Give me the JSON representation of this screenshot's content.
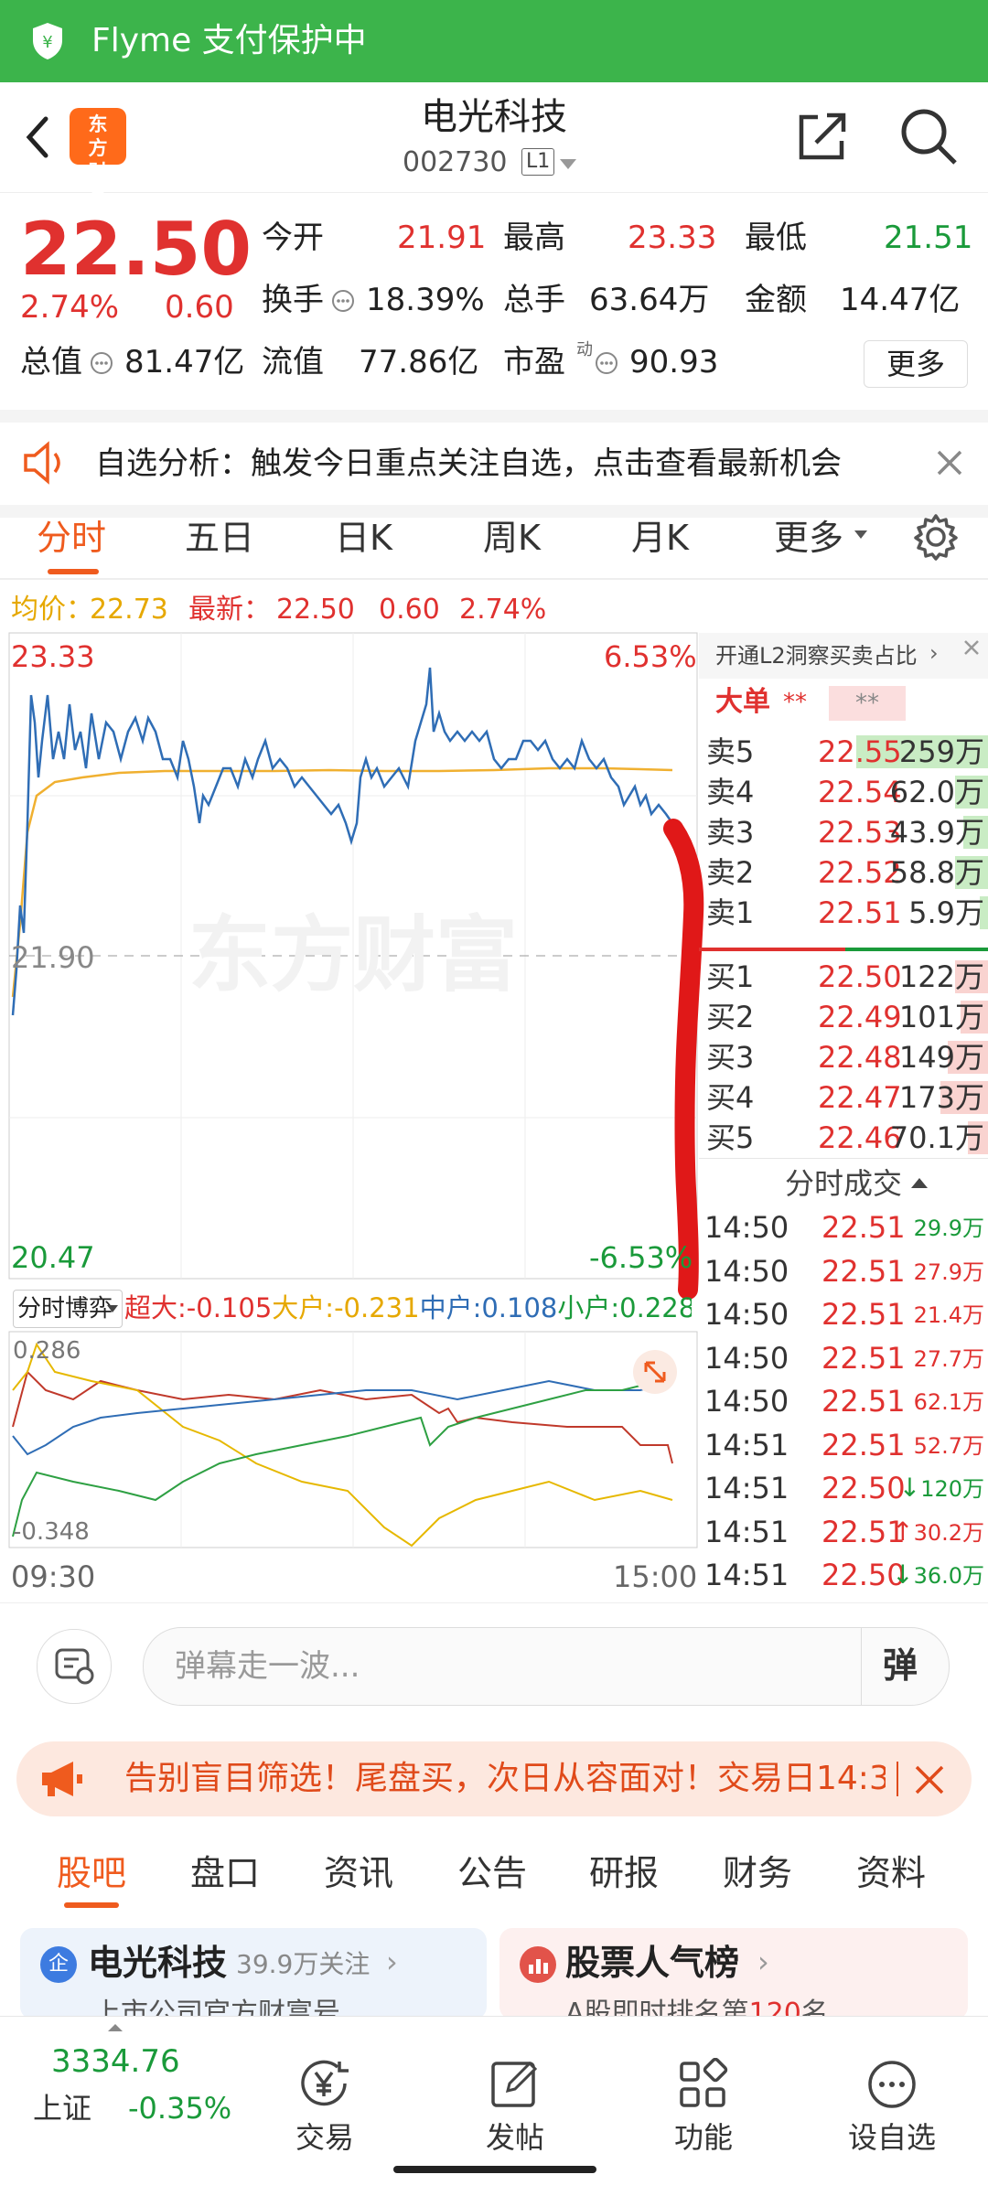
{
  "status_bar": {
    "text": "Flyme 支付保护中"
  },
  "header": {
    "logo_text": "东方财富",
    "title": "电光科技",
    "code": "002730",
    "level": "L1"
  },
  "quote": {
    "price": "22.50",
    "change_pct": "2.74%",
    "change": "0.60",
    "stats": [
      {
        "label": "今开",
        "value": "21.91",
        "color": "red"
      },
      {
        "label": "最高",
        "value": "23.33",
        "color": "red"
      },
      {
        "label": "最低",
        "value": "21.51",
        "color": "green"
      },
      {
        "label": "换手",
        "value": "18.39%",
        "color": "black"
      },
      {
        "label": "总手",
        "value": "63.64万",
        "color": "black"
      },
      {
        "label": "金额",
        "value": "14.47亿",
        "color": "black"
      },
      {
        "label": "总值",
        "value": "81.47亿",
        "color": "black"
      },
      {
        "label": "流值",
        "value": "77.86亿",
        "color": "black"
      },
      {
        "label": "市盈",
        "value": "90.93",
        "color": "black"
      }
    ],
    "pe_sup": "动",
    "more_button": "更多"
  },
  "notice": {
    "text": "自选分析：触发今日重点关注自选，点击查看最新机会"
  },
  "chart_tabs": [
    "分时",
    "五日",
    "日K",
    "周K",
    "月K",
    "更多"
  ],
  "chart_summary": {
    "avg_label": "均价：",
    "avg_value": "22.73",
    "latest_label": "最新：",
    "latest_value": "22.50",
    "change": "0.60",
    "change_pct": "2.74%"
  },
  "chart_labels": {
    "high": "23.33",
    "high_pct": "6.53%",
    "mid": "21.90",
    "low": "20.47",
    "low_pct": "-6.53%",
    "watermark": "东方财富",
    "start_time": "09:30",
    "end_time": "15:00",
    "ff_high": "0.286",
    "ff_low": "-0.348"
  },
  "fund_flow": {
    "selector": "分时博弈",
    "items": [
      {
        "label": "超大:",
        "value": "-0.105",
        "color": "#e0312f"
      },
      {
        "label": "大户:",
        "value": "-0.231",
        "color": "#e6a800"
      },
      {
        "label": "中户:",
        "value": "0.108",
        "color": "#2f6db5"
      },
      {
        "label": "小户:",
        "value": "0.228",
        "color": "#1a9a3a"
      }
    ]
  },
  "order_book": {
    "banner": "开通L2洞察买卖占比",
    "big_order_label": "大单",
    "big_order_value": "**",
    "big_order_value2": "**",
    "asks": [
      {
        "label": "卖5",
        "price": "22.55",
        "volume": "259万",
        "level": 0.8
      },
      {
        "label": "卖4",
        "price": "22.54",
        "volume": "62.0万",
        "level": 0.2
      },
      {
        "label": "卖3",
        "price": "22.53",
        "volume": "43.9万",
        "level": 0.15
      },
      {
        "label": "卖2",
        "price": "22.52",
        "volume": "58.8万",
        "level": 0.2
      },
      {
        "label": "卖1",
        "price": "22.51",
        "volume": "5.9万",
        "level": 0.05
      }
    ],
    "bids": [
      {
        "label": "买1",
        "price": "22.50",
        "volume": "122万",
        "level": 0.45
      },
      {
        "label": "买2",
        "price": "22.49",
        "volume": "101万",
        "level": 0.38
      },
      {
        "label": "买3",
        "price": "22.48",
        "volume": "149万",
        "level": 0.55
      },
      {
        "label": "买4",
        "price": "22.47",
        "volume": "173万",
        "level": 0.65
      },
      {
        "label": "买5",
        "price": "22.46",
        "volume": "70.1万",
        "level": 0.28
      }
    ],
    "trades_title": "分时成交",
    "trades": [
      {
        "time": "14:50",
        "price": "22.51",
        "volume": "29.9万",
        "dir": "",
        "color": "#1a9a3a"
      },
      {
        "time": "14:50",
        "price": "22.51",
        "volume": "27.9万",
        "dir": "",
        "color": "#e0312f"
      },
      {
        "time": "14:50",
        "price": "22.51",
        "volume": "21.4万",
        "dir": "",
        "color": "#e0312f"
      },
      {
        "time": "14:50",
        "price": "22.51",
        "volume": "27.7万",
        "dir": "",
        "color": "#e0312f"
      },
      {
        "time": "14:50",
        "price": "22.51",
        "volume": "62.1万",
        "dir": "",
        "color": "#e0312f"
      },
      {
        "time": "14:51",
        "price": "22.51",
        "volume": "52.7万",
        "dir": "",
        "color": "#e0312f"
      },
      {
        "time": "14:51",
        "price": "22.50",
        "volume": "120万",
        "dir": "↓",
        "color": "#1a9a3a"
      },
      {
        "time": "14:51",
        "price": "22.51",
        "volume": "30.2万",
        "dir": "↑",
        "color": "#e0312f"
      },
      {
        "time": "14:51",
        "price": "22.50",
        "volume": "36.0万",
        "dir": "↓",
        "color": "#1a9a3a"
      }
    ]
  },
  "danmu": {
    "placeholder": "弹幕走一波...",
    "button": "弹"
  },
  "banner": {
    "text": "告别盲目筛选！尾盘买，次日从容面对！交易日14:3"
  },
  "bottom_tabs": [
    "股吧",
    "盘口",
    "资讯",
    "公告",
    "研报",
    "财务",
    "资料"
  ],
  "cards": [
    {
      "badge": "企",
      "title": "电光科技",
      "sub": "39.9万关注",
      "desc": "上市公司官方财富号"
    },
    {
      "title": "股票人气榜",
      "desc": "A股即时排名第",
      "rank": "120",
      "rank_unit": "名"
    }
  ],
  "nav": {
    "index_value": "3334.76",
    "index_name": "上证",
    "index_change": "-0.35%",
    "items": [
      "交易",
      "发帖",
      "功能",
      "设自选"
    ]
  },
  "colors": {
    "brand_green": "#3cb44b",
    "accent_orange": "#ef5b1e",
    "up_red": "#e0312f",
    "down_green": "#1a9a3a",
    "price_line": "#2f6db5",
    "avg_line": "#f0b030"
  }
}
